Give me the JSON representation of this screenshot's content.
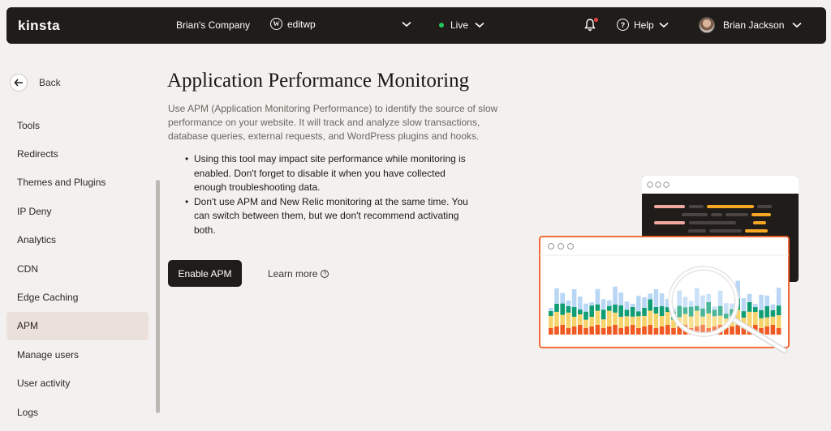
{
  "topbar": {
    "logo": "kinsta",
    "company": "Brian's Company",
    "site": "editwp",
    "environment": "Live",
    "help": "Help",
    "user": "Brian Jackson",
    "icons": [
      "wordpress-icon",
      "chevron-down-icon",
      "bell-icon",
      "help-icon",
      "avatar"
    ],
    "status_color": "#22c55e",
    "notification_color": "#ef4444"
  },
  "sidebar": {
    "back": "Back",
    "items": [
      {
        "label": "Tools"
      },
      {
        "label": "Redirects"
      },
      {
        "label": "Themes and Plugins"
      },
      {
        "label": "IP Deny"
      },
      {
        "label": "Analytics"
      },
      {
        "label": "CDN"
      },
      {
        "label": "Edge Caching"
      },
      {
        "label": "APM",
        "active": true
      },
      {
        "label": "Manage users"
      },
      {
        "label": "User activity"
      },
      {
        "label": "Logs"
      }
    ]
  },
  "main": {
    "title": "Application Performance Monitoring",
    "description": "Use APM (Application Monitoring Performance) to identify the source of slow performance on your website. It will track and analyze slow transactions, database queries, external requests, and WordPress plugins and hooks.",
    "bullets": [
      "Using this tool may impact site performance while monitoring is enabled. Don't forget to disable it when you have collected enough troubleshooting data.",
      "Don't use APM and New Relic monitoring at the same time. You can switch between them, but we don't recommend activating both."
    ],
    "enable_button": "Enable APM",
    "learn_more": "Learn more"
  },
  "colors": {
    "accent": "#1f1c1a",
    "orange": "#f05a22",
    "yellow": "#f7d46b",
    "green": "#0f9d74",
    "blue": "#b9d7f5"
  }
}
